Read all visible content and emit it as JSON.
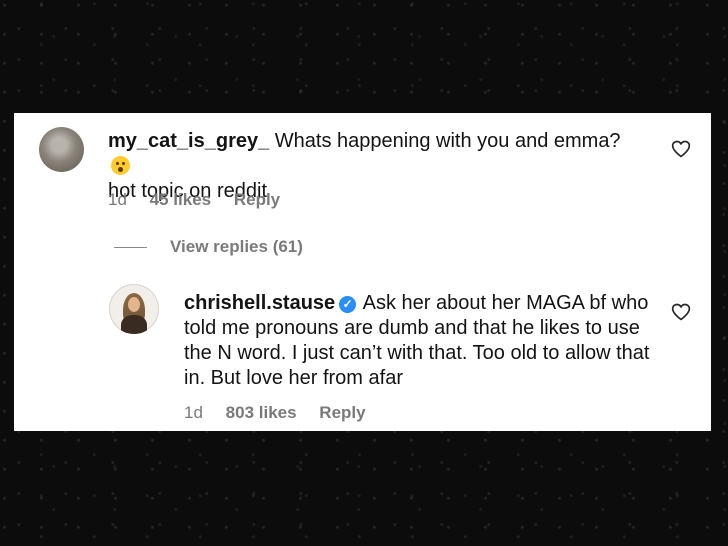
{
  "comments": [
    {
      "username": "my_cat_is_grey_",
      "text": "Whats happening with you and emma?",
      "emoji": "astonished-face-emoji",
      "text_line2": "hot topic on reddit",
      "age": "1d",
      "likes": "45 likes",
      "reply_label": "Reply"
    },
    {
      "username": "chrishell.stause",
      "verified": true,
      "text": "Ask her about her MAGA bf who told me pronouns are dumb and that he likes to use the N word. I just can’t with that. Too old to allow that in. But love her from afar",
      "age": "1d",
      "likes": "803 likes",
      "reply_label": "Reply"
    }
  ],
  "view_replies_label": "View replies (61)",
  "icons": {
    "like": "heart-outline-icon",
    "verified": "verified-check-icon"
  },
  "colors": {
    "background": "#0c0c0c",
    "card": "#ffffff",
    "text": "#141414",
    "meta": "#7a7a7a",
    "verified": "#2b8df5",
    "emoji": "#ffcc33"
  }
}
